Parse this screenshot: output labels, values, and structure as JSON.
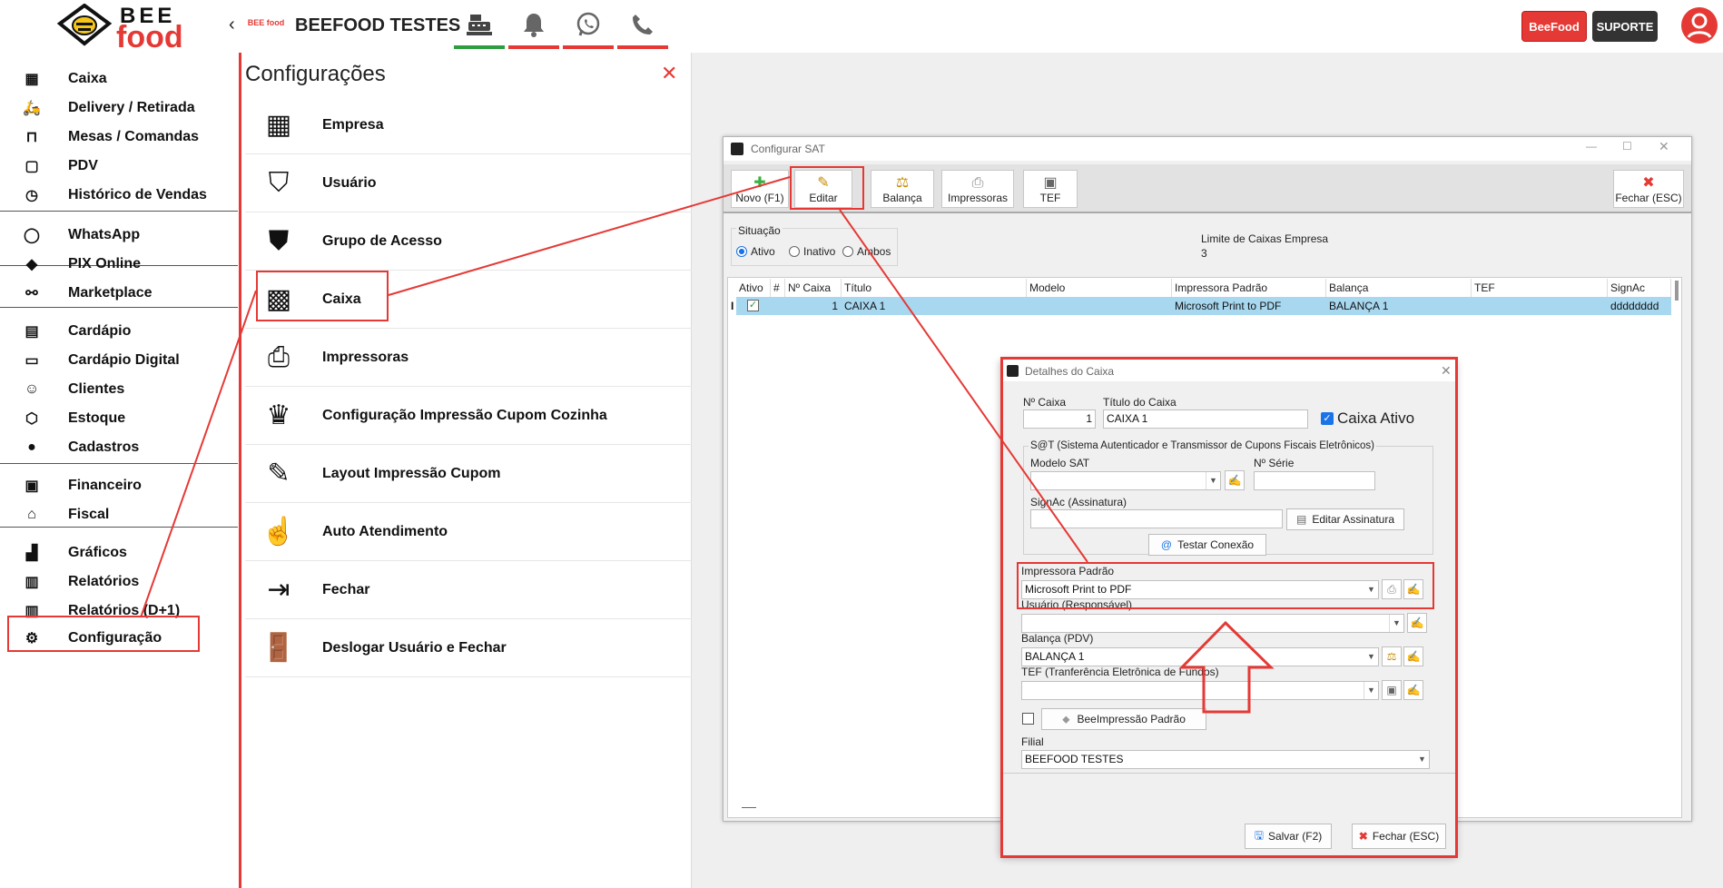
{
  "header": {
    "logo_top": "BEE",
    "logo_bottom": "food",
    "collapse_icon": "chevron-left-icon",
    "store_logo_text": "BEE food",
    "store_name": "BEEFOOD TESTES",
    "tabs": [
      {
        "icon": "cash-register-icon",
        "bar_color": "#2e9d3f"
      },
      {
        "icon": "bell-icon",
        "bar_color": "#e53935"
      },
      {
        "icon": "whatsapp-icon",
        "bar_color": "#e53935"
      },
      {
        "icon": "phone-icon",
        "bar_color": "#e53935"
      }
    ],
    "beefood_button": "BeeFood",
    "support_button": "SUPORTE"
  },
  "sidebar": {
    "items": [
      {
        "label": "Caixa",
        "icon": "cash-register-icon"
      },
      {
        "label": "Delivery / Retirada",
        "icon": "scooter-icon"
      },
      {
        "label": "Mesas / Comandas",
        "icon": "table-icon"
      },
      {
        "label": "PDV",
        "icon": "shopping-bag-icon"
      },
      {
        "label": "Histórico de Vendas",
        "icon": "receipt-clock-icon"
      },
      {
        "label": "WhatsApp",
        "icon": "whatsapp-icon"
      },
      {
        "label": "PIX Online",
        "icon": "pix-icon"
      },
      {
        "label": "Marketplace",
        "icon": "webhook-icon"
      },
      {
        "label": "Cardápio",
        "icon": "menu-book-icon"
      },
      {
        "label": "Cardápio Digital",
        "icon": "storefront-icon"
      },
      {
        "label": "Clientes",
        "icon": "users-icon"
      },
      {
        "label": "Estoque",
        "icon": "box-icon"
      },
      {
        "label": "Cadastros",
        "icon": "more-circle-icon"
      },
      {
        "label": "Financeiro",
        "icon": "money-icon"
      },
      {
        "label": "Fiscal",
        "icon": "bank-icon"
      },
      {
        "label": "Gráficos",
        "icon": "chart-icon"
      },
      {
        "label": "Relatórios",
        "icon": "report-icon"
      },
      {
        "label": "Relatórios (D+1)",
        "icon": "report-icon"
      },
      {
        "label": "Configuração",
        "icon": "gear-icon"
      }
    ]
  },
  "config": {
    "title": "Configurações",
    "close_icon": "close-icon",
    "items": [
      {
        "label": "Empresa",
        "icon": "building-gear-icon"
      },
      {
        "label": "Usuário",
        "icon": "user-shield-icon"
      },
      {
        "label": "Grupo de Acesso",
        "icon": "shield-lock-icon"
      },
      {
        "label": "Caixa",
        "icon": "calculator-icon"
      },
      {
        "label": "Impressoras",
        "icon": "printer-gear-icon"
      },
      {
        "label": "Configuração Impressão Cupom Cozinha",
        "icon": "chef-hat-icon"
      },
      {
        "label": "Layout Impressão Cupom",
        "icon": "printer-edit-icon"
      },
      {
        "label": "Auto Atendimento",
        "icon": "touch-screen-icon"
      },
      {
        "label": "Fechar",
        "icon": "exit-icon"
      },
      {
        "label": "Deslogar Usuário e Fechar",
        "icon": "door-exit-icon"
      }
    ]
  },
  "sat": {
    "title": "Configurar SAT",
    "toolbar": {
      "novo": "Novo (F1)",
      "editar": "Editar",
      "balanca": "Balança",
      "impressoras": "Impressoras",
      "tef": "TEF",
      "fechar": "Fechar (ESC)"
    },
    "situacao_label": "Situação",
    "radios": [
      "Ativo",
      "Inativo",
      "Ambos"
    ],
    "limite_label": "Limite de Caixas Empresa",
    "limite_value": "3",
    "columns": [
      "Ativo",
      "#",
      "Nº Caixa",
      "Título",
      "Modelo",
      "Impressora Padrão",
      "Balança",
      "TEF",
      "SignAc"
    ],
    "row": {
      "cursor": "I",
      "caixa": "1",
      "titulo": "CAIXA 1",
      "modelo": "",
      "impressora": "Microsoft Print to PDF",
      "balanca": "BALANÇA 1",
      "tef": "",
      "signac": "dddddddd"
    }
  },
  "detalhes": {
    "title": "Detalhes do Caixa",
    "n_caixa_label": "Nº Caixa",
    "n_caixa_value": "1",
    "titulo_label": "Título do Caixa",
    "titulo_value": "CAIXA 1",
    "ativo_label": "Caixa Ativo",
    "sat_group": "S@T (Sistema Autenticador e Transmissor de Cupons Fiscais Eletrônicos)",
    "modelo_sat_label": "Modelo SAT",
    "serie_label": "Nº Série",
    "signac_label": "SignAc (Assinatura)",
    "editar_assinatura": "Editar Assinatura",
    "testar_conexao": "Testar Conexão",
    "impressora_label": "Impressora Padrão",
    "impressora_value": "Microsoft Print to PDF",
    "usuario_label": "Usuário (Responsável)",
    "balanca_label": "Balança (PDV)",
    "balanca_value": "BALANÇA 1",
    "tef_label": "TEF (Tranferência Eletrônica de Fundos)",
    "beeimpressao": "BeeImpressão Padrão",
    "filial_label": "Filial",
    "filial_value": "BEEFOOD TESTES",
    "salvar": "Salvar (F2)",
    "fechar": "Fechar (ESC)"
  },
  "colors": {
    "accent": "#e53935",
    "dark": "#333333",
    "selected_row": "#a8d8f0"
  }
}
